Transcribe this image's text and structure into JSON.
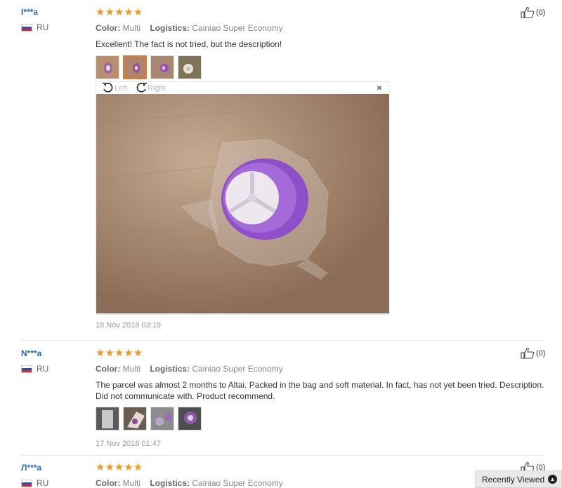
{
  "reviews": [
    {
      "user": "I***a",
      "country": "RU",
      "stars": "★★★★★",
      "color_label": "Color:",
      "color_value": "Multi",
      "logistics_label": "Logistics:",
      "logistics_value": "Cainiao Super Economy",
      "text": "Excellent! The fact is not tried, but the description!",
      "date": "18 Nov 2018 03:19",
      "helpful": "(0)"
    },
    {
      "user": "N***a",
      "country": "RU",
      "stars": "★★★★★",
      "color_label": "Color:",
      "color_value": "Multi",
      "logistics_label": "Logistics:",
      "logistics_value": "Cainiao Super Economy",
      "text": "The parcel was almost 2 months to Altai. Packed in the bag and soft material. In fact, has not yet been tried. Description. Did not communicate with. Product recommend.",
      "date": "17 Nov 2018 01:47",
      "helpful": "(0)"
    },
    {
      "user": "Л***a",
      "country": "RU",
      "stars": "★★★★★",
      "color_label": "Color:",
      "color_value": "Multi",
      "logistics_label": "Logistics:",
      "logistics_value": "Cainiao Super Economy",
      "helpful": "(0)"
    }
  ],
  "viewer": {
    "rotate_left": "Left",
    "rotate_right": "Right",
    "close": "×"
  },
  "recently_viewed": "Recently Viewed",
  "icons": {
    "helpful": "thumbs-up-icon",
    "rotate_left": "rotate-left-icon",
    "rotate_right": "rotate-right-icon",
    "close": "close-icon",
    "recent": "chevron-up-circle-icon",
    "flag": "russia-flag-icon"
  },
  "colors": {
    "star": "#f39a1e",
    "username": "#2c6aa6",
    "active_thumb_border": "#e0792a"
  }
}
